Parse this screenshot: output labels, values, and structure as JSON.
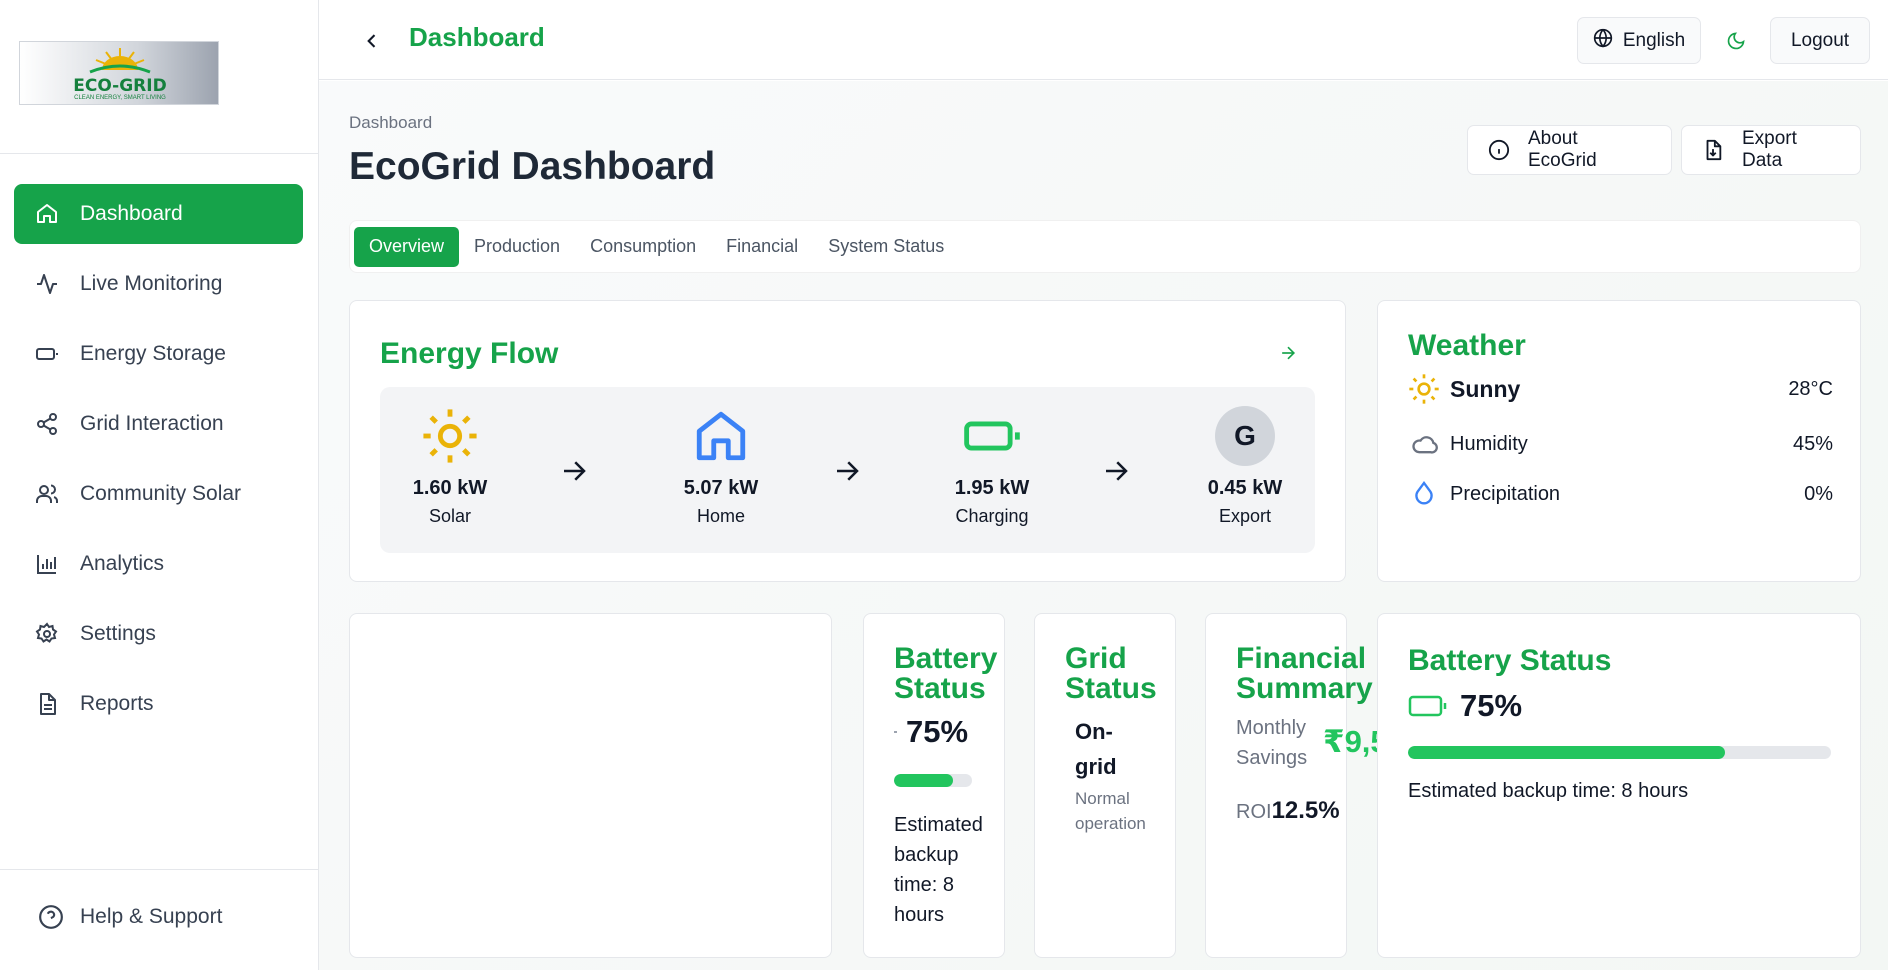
{
  "sidebar": {
    "logo": {
      "name": "ECO-GRID",
      "tagline": "CLEAN ENERGY, SMART LIVING"
    },
    "items": [
      {
        "label": "Dashboard",
        "icon": "home-icon",
        "active": true
      },
      {
        "label": "Live Monitoring",
        "icon": "activity-icon"
      },
      {
        "label": "Energy Storage",
        "icon": "battery-icon"
      },
      {
        "label": "Grid Interaction",
        "icon": "share-icon"
      },
      {
        "label": "Community Solar",
        "icon": "users-icon"
      },
      {
        "label": "Analytics",
        "icon": "bar-chart-icon"
      },
      {
        "label": "Settings",
        "icon": "gear-icon"
      },
      {
        "label": "Reports",
        "icon": "file-icon"
      }
    ],
    "help_label": "Help & Support"
  },
  "topbar": {
    "title": "Dashboard",
    "language": "English",
    "logout": "Logout"
  },
  "header": {
    "breadcrumb": "Dashboard",
    "title": "EcoGrid Dashboard",
    "about_label": "About EcoGrid",
    "export_label": "Export Data"
  },
  "tabs": [
    {
      "label": "Overview",
      "active": true
    },
    {
      "label": "Production"
    },
    {
      "label": "Consumption"
    },
    {
      "label": "Financial"
    },
    {
      "label": "System Status"
    }
  ],
  "energy_flow": {
    "title": "Energy Flow",
    "nodes": [
      {
        "value": "1.60 kW",
        "label": "Solar",
        "icon": "sun-icon"
      },
      {
        "value": "5.07 kW",
        "label": "Home",
        "icon": "home-icon"
      },
      {
        "value": "1.95 kW",
        "label": "Charging",
        "icon": "battery-icon"
      },
      {
        "value": "0.45 kW",
        "label": "Export",
        "icon": "grid-badge",
        "badge": "G"
      }
    ]
  },
  "weather": {
    "title": "Weather",
    "condition": "Sunny",
    "temperature": "28°C",
    "humidity_label": "Humidity",
    "humidity": "45%",
    "precipitation_label": "Precipitation",
    "precipitation": "0%"
  },
  "battery_small": {
    "title_1": "Battery",
    "title_2": "Status",
    "percent": "75%",
    "level": 0.75,
    "backup_lines": [
      "Estimated",
      "backup",
      "time: 8",
      "hours"
    ]
  },
  "grid_small": {
    "title_1": "Grid",
    "title_2": "Status",
    "status_1": "On-",
    "status_2": "grid",
    "note_1": "Normal",
    "note_2": "operation"
  },
  "financial_small": {
    "title_1": "Financial",
    "title_2": "Summary",
    "savings_label_1": "Monthly",
    "savings_label_2": "Savings",
    "savings_value": "₹9,5",
    "roi_label": "ROI",
    "roi_value": "12.5%"
  },
  "battery_big": {
    "title": "Battery Status",
    "percent": "75%",
    "level": 0.75,
    "backup": "Estimated backup time: 8 hours"
  },
  "colors": {
    "accent": "#16a34a",
    "bar_fill": "#22c55e",
    "sun": "#eab308",
    "home": "#3b82f6"
  }
}
